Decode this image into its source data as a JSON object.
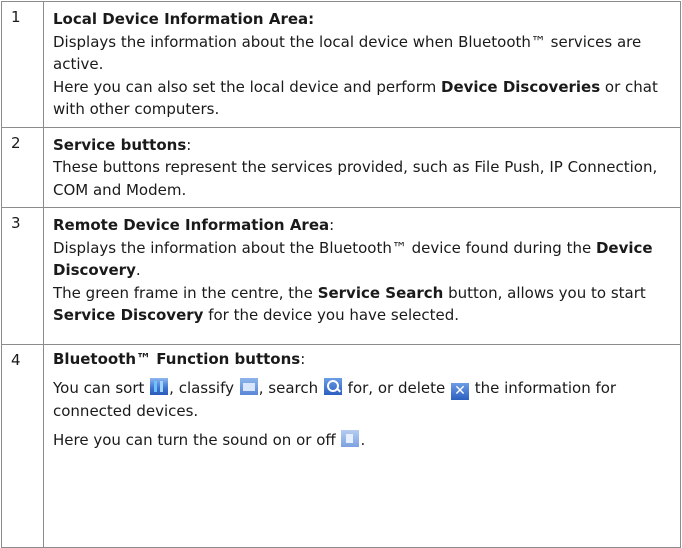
{
  "rows": [
    {
      "number": "1",
      "title": "Local Device Information Area:",
      "line1": "Displays the information about the local device when Bluetooth™ services are active.",
      "line2_pre": "Here you can also set the local device and perform ",
      "line2_bold": "Device Discoveries",
      "line2_post": " or chat with other computers."
    },
    {
      "number": "2",
      "title": "Service buttons",
      "title_suffix": ":",
      "line1": "These buttons represent the services provided, such as File Push, IP Connection, COM and Modem."
    },
    {
      "number": "3",
      "title": "Remote Device Information Area",
      "title_suffix": ":",
      "line1_pre": "Displays the information about the Bluetooth™ device found during the ",
      "line1_bold": "Device Discovery",
      "line1_post": ".",
      "line2_pre": "The green frame in the centre, the ",
      "line2_bold1": "Service Search",
      "line2_mid": " button, allows you to start ",
      "line2_bold2": "Service Discovery",
      "line2_post": " for the device you have selected."
    },
    {
      "number": "4",
      "title": "Bluetooth™ Function buttons",
      "title_suffix": ":",
      "p1_a": "You can sort ",
      "p1_b": ", classify ",
      "p1_c": ", search ",
      "p1_d": " for, or delete ",
      "p1_e": " the information for connected devices.",
      "p2_a": "Here you can turn the sound on or off ",
      "p2_b": "."
    }
  ],
  "icons": [
    "sort-icon",
    "classify-icon",
    "search-icon",
    "delete-icon",
    "sound-icon"
  ],
  "colors": {
    "border": "#8c8c8c",
    "icon_blue": "#3d73cf"
  }
}
